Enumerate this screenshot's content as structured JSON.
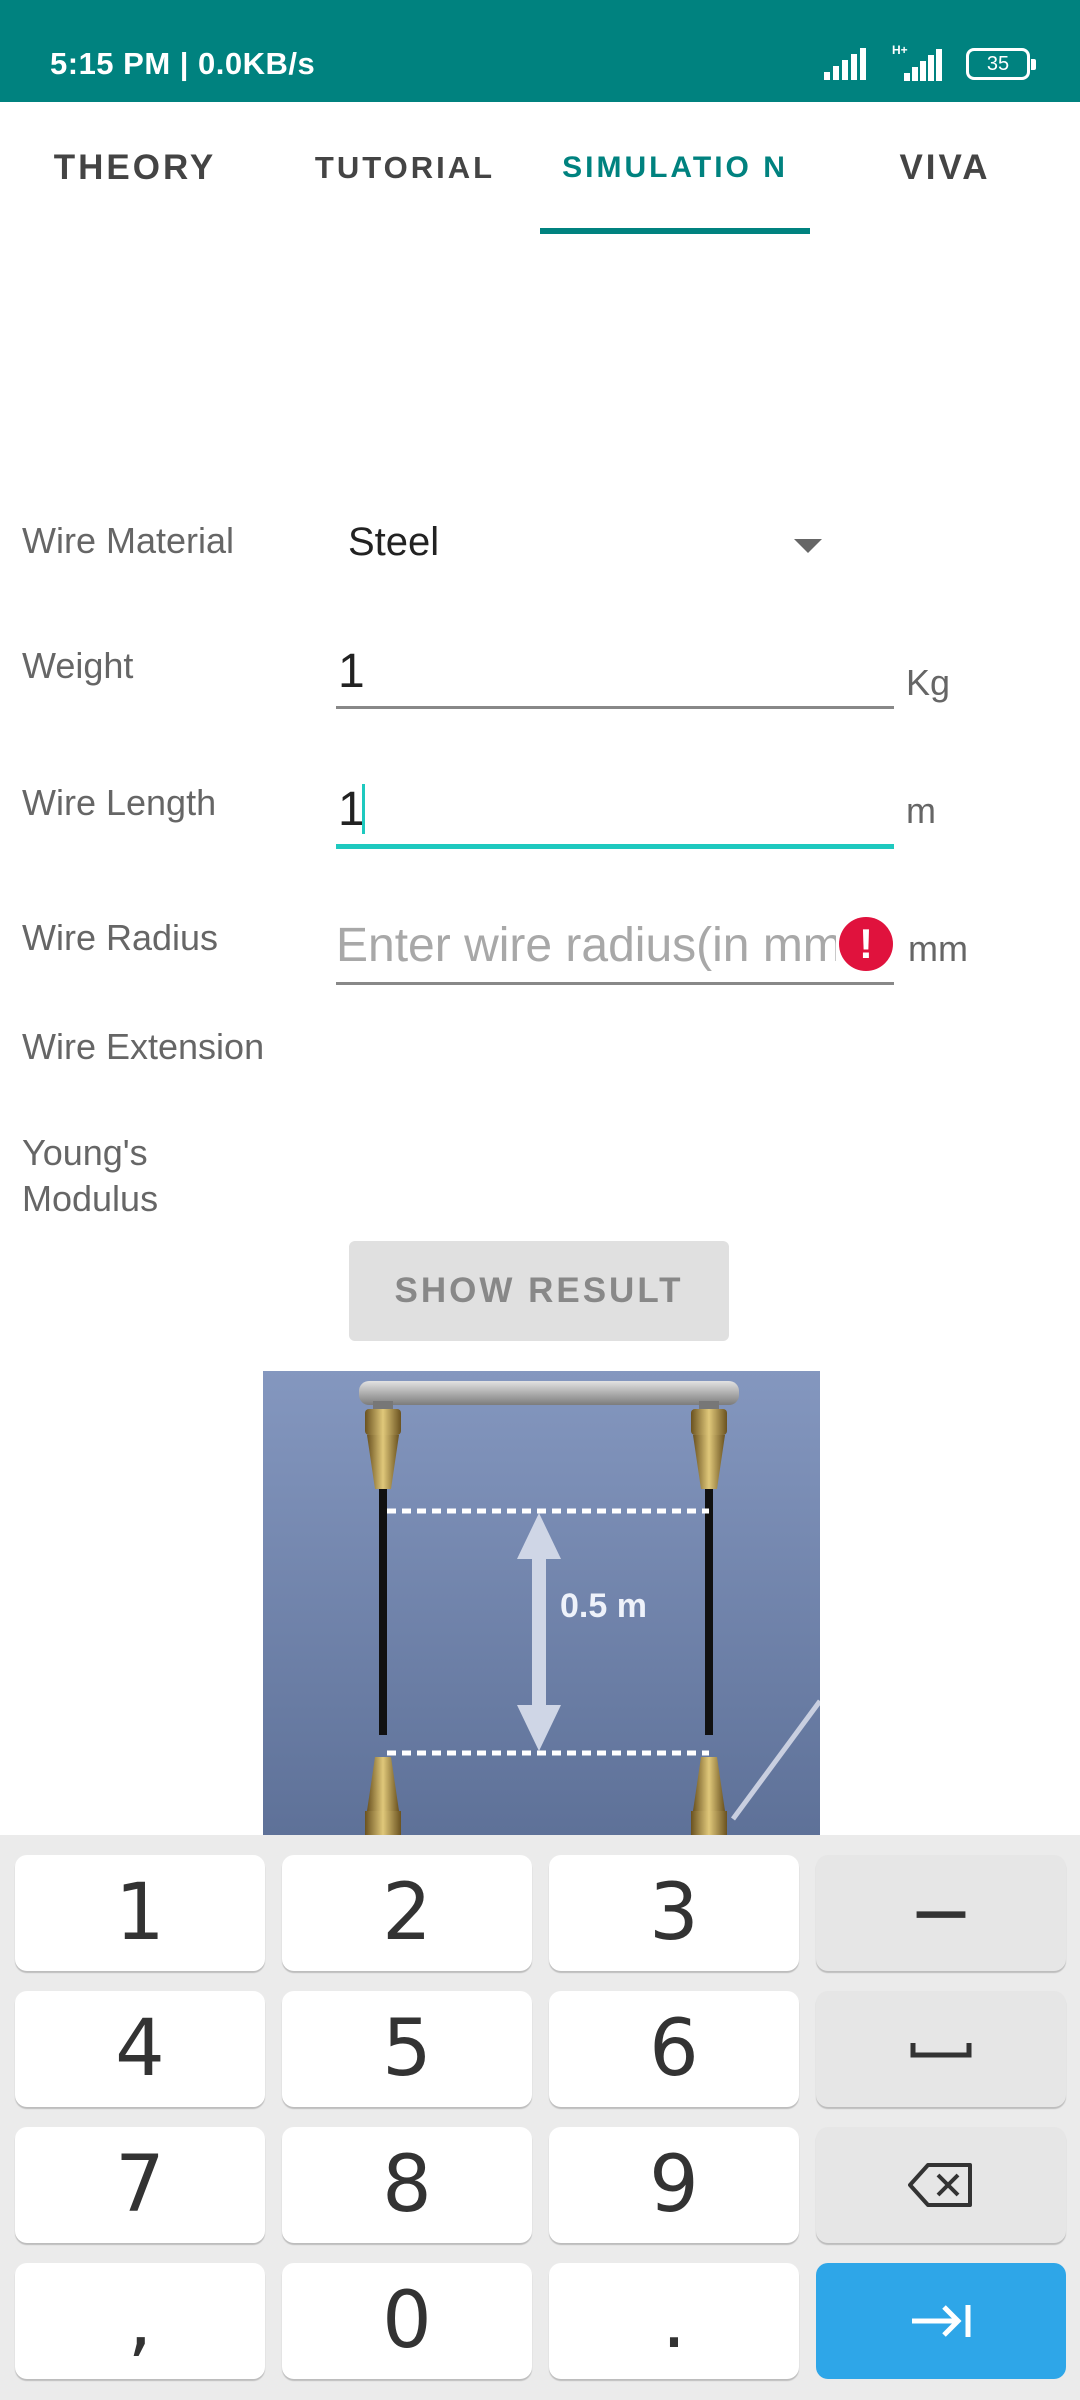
{
  "status_bar": {
    "time": "5:15 PM | 0.0KB/s",
    "network_label": "H+",
    "battery": "35"
  },
  "tabs": [
    {
      "label": "THEORY"
    },
    {
      "label": "TUTORIAL"
    },
    {
      "label": "SIMULATIO N",
      "active": true
    },
    {
      "label": "VIVA"
    }
  ],
  "form": {
    "material": {
      "label": "Wire Material",
      "value": "Steel"
    },
    "weight": {
      "label": "Weight",
      "value": "1",
      "unit": "Kg"
    },
    "length": {
      "label": "Wire Length",
      "value": "1",
      "unit": "m"
    },
    "radius": {
      "label": "Wire Radius",
      "placeholder": "Enter wire radius(in mm",
      "unit": "mm",
      "error_icon": "!"
    },
    "extension": {
      "label": "Wire Extension"
    },
    "youngs": {
      "label": "Young's Modulus"
    }
  },
  "button": {
    "label": "SHOW RESULT"
  },
  "simulation": {
    "dimension_label": "0.5 m"
  },
  "keyboard": {
    "keys": [
      [
        "1",
        "2",
        "3",
        "−"
      ],
      [
        "4",
        "5",
        "6",
        "space"
      ],
      [
        "7",
        "8",
        "9",
        "backspace"
      ],
      [
        ",",
        "0",
        ".",
        "tab"
      ]
    ]
  },
  "colors": {
    "accent": "#00827f",
    "error": "#e0123d",
    "focus_line": "#1ec9bf",
    "enter_key": "#2ea6e8"
  }
}
